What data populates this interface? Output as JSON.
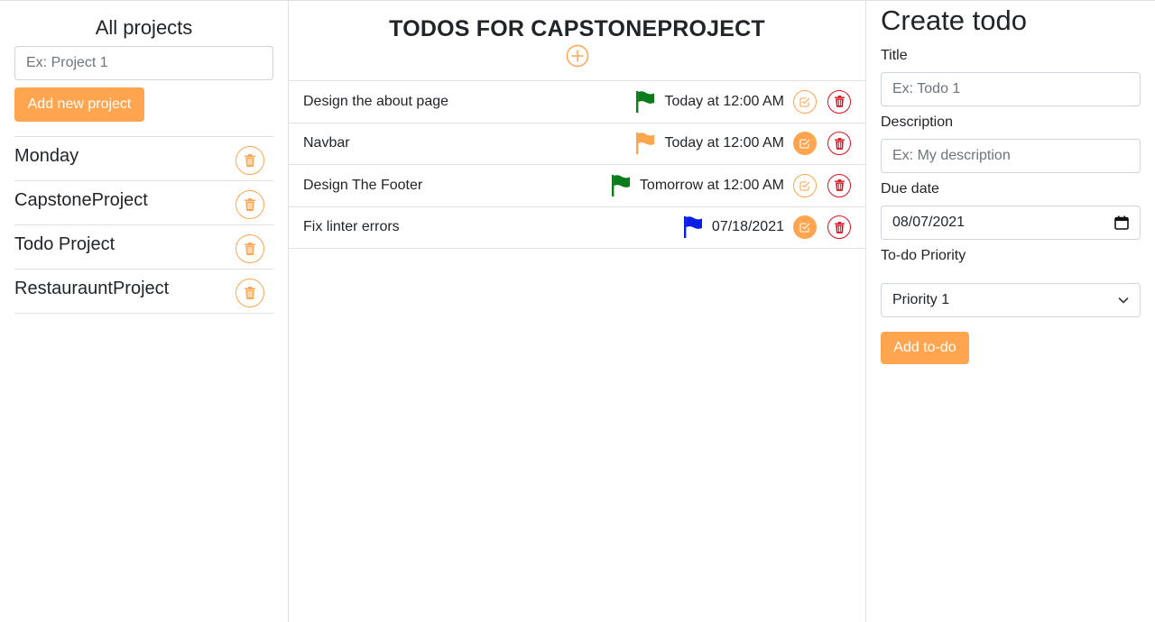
{
  "projects_panel": {
    "title": "All projects",
    "input_placeholder": "Ex: Project 1",
    "add_button_label": "Add new project",
    "projects": [
      {
        "name": "Monday"
      },
      {
        "name": "CapstoneProject"
      },
      {
        "name": "Todo Project"
      },
      {
        "name": "RestaurauntProject"
      }
    ]
  },
  "todos_panel": {
    "title": "TODOS FOR CAPSTONEPROJECT",
    "todos": [
      {
        "title": "Design the about page",
        "due": "Today at 12:00 AM",
        "flag_color": "#0a7d1a",
        "completed": false
      },
      {
        "title": "Navbar",
        "due": "Today at 12:00 AM",
        "flag_color": "#ffa550",
        "completed": true
      },
      {
        "title": "Design The Footer",
        "due": "Tomorrow at 12:00 AM",
        "flag_color": "#0a7d1a",
        "completed": false
      },
      {
        "title": "Fix linter errors",
        "due": "07/18/2021",
        "flag_color": "#0a1ee6",
        "completed": true
      }
    ]
  },
  "create_panel": {
    "title": "Create todo",
    "title_label": "Title",
    "title_placeholder": "Ex: Todo 1",
    "description_label": "Description",
    "description_placeholder": "Ex: My description",
    "due_label": "Due date",
    "due_value": "08/07/2021",
    "priority_label": "To-do Priority",
    "priority_value": "Priority 1",
    "submit_label": "Add to-do"
  },
  "colors": {
    "accent": "#ffa550",
    "danger": "#e0101e",
    "border": "#dee2e6"
  }
}
